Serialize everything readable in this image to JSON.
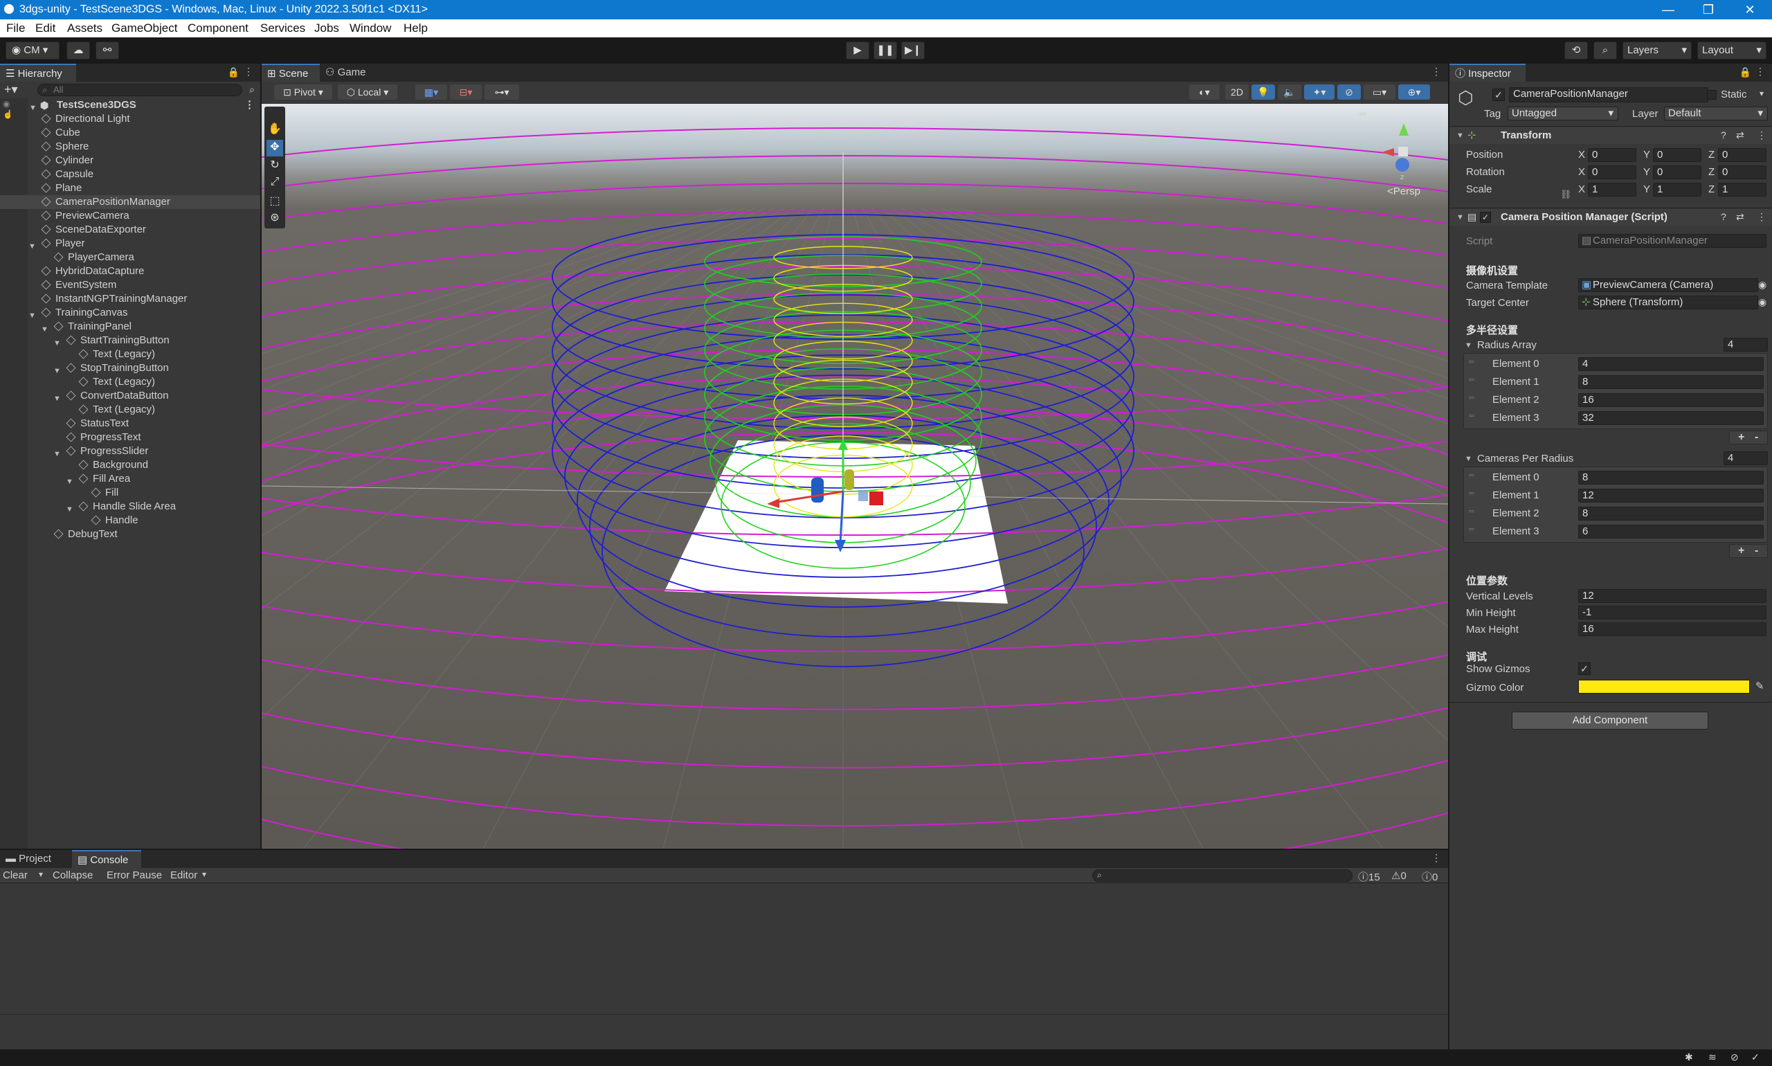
{
  "window": {
    "title": "3dgs-unity - TestScene3DGS - Windows, Mac, Linux - Unity 2022.3.50f1c1 <DX11>",
    "controls": [
      "—",
      "❐",
      "✕"
    ]
  },
  "menu": [
    "File",
    "Edit",
    "Assets",
    "GameObject",
    "Component",
    "Services",
    "Jobs",
    "Window",
    "Help"
  ],
  "toolbar": {
    "account": "CM",
    "play_icons": [
      "play-icon",
      "pause-icon",
      "step-icon"
    ],
    "layers": "Layers",
    "layout": "Layout"
  },
  "hierarchy": {
    "tab": "Hierarchy",
    "search_placeholder": "All",
    "scene": "TestScene3DGS",
    "items": [
      {
        "label": "Directional Light",
        "depth": 1
      },
      {
        "label": "Cube",
        "depth": 1
      },
      {
        "label": "Sphere",
        "depth": 1
      },
      {
        "label": "Cylinder",
        "depth": 1
      },
      {
        "label": "Capsule",
        "depth": 1
      },
      {
        "label": "Plane",
        "depth": 1
      },
      {
        "label": "CameraPositionManager",
        "depth": 1,
        "selected": true
      },
      {
        "label": "PreviewCamera",
        "depth": 1
      },
      {
        "label": "SceneDataExporter",
        "depth": 1
      },
      {
        "label": "Player",
        "depth": 1,
        "expanded": true
      },
      {
        "label": "PlayerCamera",
        "depth": 2
      },
      {
        "label": "HybridDataCapture",
        "depth": 1
      },
      {
        "label": "EventSystem",
        "depth": 1
      },
      {
        "label": "InstantNGPTrainingManager",
        "depth": 1
      },
      {
        "label": "TrainingCanvas",
        "depth": 1,
        "expanded": true
      },
      {
        "label": "TrainingPanel",
        "depth": 2,
        "expanded": true
      },
      {
        "label": "StartTrainingButton",
        "depth": 3,
        "expanded": true
      },
      {
        "label": "Text (Legacy)",
        "depth": 4
      },
      {
        "label": "StopTrainingButton",
        "depth": 3,
        "expanded": true
      },
      {
        "label": "Text (Legacy)",
        "depth": 4
      },
      {
        "label": "ConvertDataButton",
        "depth": 3,
        "expanded": true
      },
      {
        "label": "Text (Legacy)",
        "depth": 4
      },
      {
        "label": "StatusText",
        "depth": 3
      },
      {
        "label": "ProgressText",
        "depth": 3
      },
      {
        "label": "ProgressSlider",
        "depth": 3,
        "expanded": true
      },
      {
        "label": "Background",
        "depth": 4
      },
      {
        "label": "Fill Area",
        "depth": 4,
        "expanded": true
      },
      {
        "label": "Fill",
        "depth": 5
      },
      {
        "label": "Handle Slide Area",
        "depth": 4,
        "expanded": true
      },
      {
        "label": "Handle",
        "depth": 5
      },
      {
        "label": "DebugText",
        "depth": 2
      }
    ]
  },
  "scene_view": {
    "tabs": [
      "Scene",
      "Game"
    ],
    "pivot": "Pivot",
    "local": "Local",
    "mode_2d": "2D",
    "gizmo_label": "Persp",
    "axis_x": "x",
    "axis_z": "z"
  },
  "inspector": {
    "tab": "Inspector",
    "object_name": "CameraPositionManager",
    "static_label": "Static",
    "tag_label": "Tag",
    "tag_value": "Untagged",
    "layer_label": "Layer",
    "layer_value": "Default",
    "transform": {
      "title": "Transform",
      "rows": [
        {
          "label": "Position",
          "x": "0",
          "y": "0",
          "z": "0"
        },
        {
          "label": "Rotation",
          "x": "0",
          "y": "0",
          "z": "0"
        },
        {
          "label": "Scale",
          "x": "1",
          "y": "1",
          "z": "1"
        }
      ]
    },
    "script_component": {
      "title": "Camera Position Manager (Script)",
      "script_label": "Script",
      "script_value": "CameraPositionManager",
      "camera_header": "摄像机设置",
      "camera_template_label": "Camera Template",
      "camera_template_value": "PreviewCamera (Camera)",
      "target_center_label": "Target Center",
      "target_center_value": "Sphere (Transform)",
      "radius_header": "多半径设置",
      "radius_array_label": "Radius Array",
      "radius_array_size": "4",
      "radius_array": [
        {
          "label": "Element 0",
          "value": "4"
        },
        {
          "label": "Element 1",
          "value": "8"
        },
        {
          "label": "Element 2",
          "value": "16"
        },
        {
          "label": "Element 3",
          "value": "32"
        }
      ],
      "cameras_per_radius_label": "Cameras Per Radius",
      "cameras_per_radius_size": "4",
      "cameras_per_radius": [
        {
          "label": "Element 0",
          "value": "8"
        },
        {
          "label": "Element 1",
          "value": "12"
        },
        {
          "label": "Element 2",
          "value": "8"
        },
        {
          "label": "Element 3",
          "value": "6"
        }
      ],
      "position_header": "位置参数",
      "vertical_levels_label": "Vertical Levels",
      "vertical_levels": "12",
      "min_height_label": "Min Height",
      "min_height": "-1",
      "max_height_label": "Max Height",
      "max_height": "16",
      "debug_header": "调试",
      "show_gizmos_label": "Show Gizmos",
      "show_gizmos": "✓",
      "gizmo_color_label": "Gizmo Color",
      "gizmo_color": "#ffe814",
      "plus": "+",
      "minus": "-"
    },
    "add_component": "Add Component"
  },
  "bottom": {
    "tabs": [
      "Project",
      "Console"
    ],
    "clear": "Clear",
    "collapse": "Collapse",
    "error_pause": "Error Pause",
    "editor": "Editor",
    "count_info": "15",
    "count_warn": "0",
    "count_error": "0"
  },
  "colors": {
    "accent": "#3a79bb",
    "title_bar": "#0e78cf",
    "ring_magenta": "#d21ed2",
    "ring_blue": "#1e1ed2",
    "ring_green": "#1ed21e",
    "ring_yellow": "#e6e614"
  }
}
